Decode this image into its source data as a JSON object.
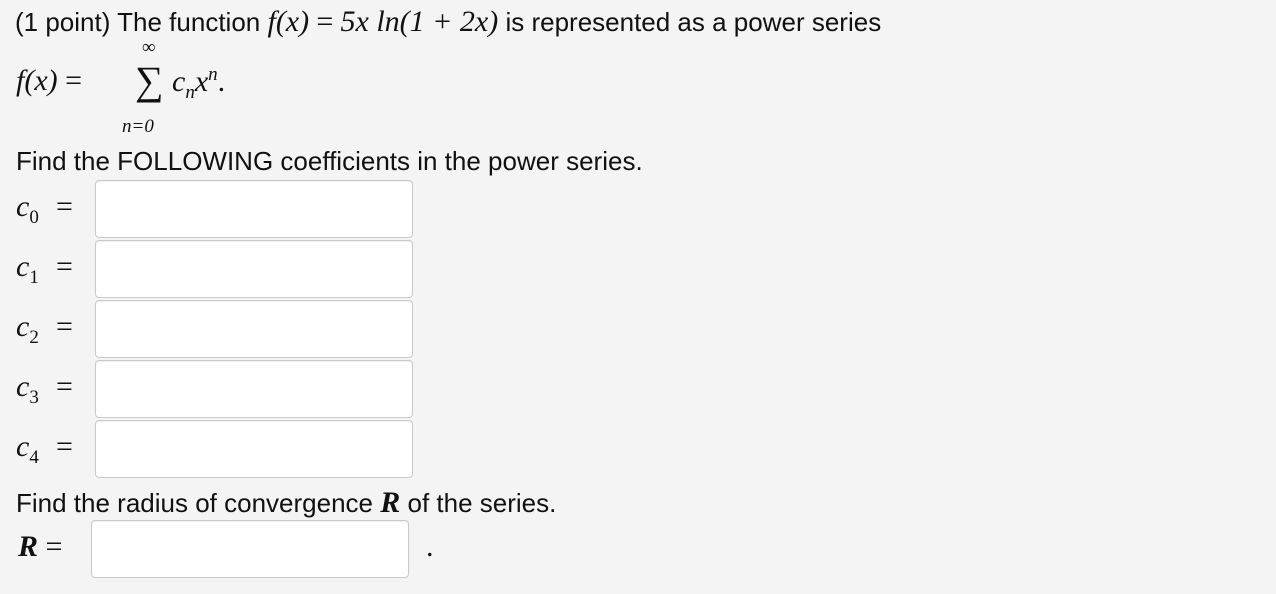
{
  "problem": {
    "points": "(1 point)",
    "intro": "The function",
    "function_lhs": "f(x)",
    "equals": "=",
    "function_rhs": "5x ln(1 + 2x)",
    "represented_text": "is represented as a power series"
  },
  "series": {
    "lhs": "f(x)",
    "equals": "=",
    "upper_limit": "∞",
    "sigma": "∑",
    "term_coef": "c",
    "term_coef_sub": "n",
    "term_var": "x",
    "term_var_sup": "n",
    "end_punct": ".",
    "lower_limit": "n=0"
  },
  "coefficients_prompt": "Find the FOLLOWING coefficients in the power series.",
  "coefficients": [
    {
      "symbol": "c",
      "sub": "0",
      "equals": "=",
      "value": ""
    },
    {
      "symbol": "c",
      "sub": "1",
      "equals": "=",
      "value": ""
    },
    {
      "symbol": "c",
      "sub": "2",
      "equals": "=",
      "value": ""
    },
    {
      "symbol": "c",
      "sub": "3",
      "equals": "=",
      "value": ""
    },
    {
      "symbol": "c",
      "sub": "4",
      "equals": "=",
      "value": ""
    }
  ],
  "radius_prompt": {
    "before": "Find the radius of convergence",
    "symbol": "R",
    "after": "of the series."
  },
  "radius_answer": {
    "symbol": "R",
    "equals": "=",
    "value": "",
    "trailing": "."
  }
}
